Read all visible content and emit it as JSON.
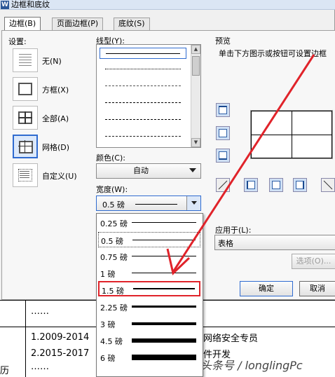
{
  "window": {
    "title": "边框和底纹",
    "icon": "word-app-icon"
  },
  "tabs": [
    {
      "label": "边框(B)"
    },
    {
      "label": "页面边框(P)"
    },
    {
      "label": "底纹(S)"
    }
  ],
  "setting": {
    "label": "设置:",
    "options": [
      {
        "label": "无(N)"
      },
      {
        "label": "方框(X)"
      },
      {
        "label": "全部(A)"
      },
      {
        "label": "网格(D)"
      },
      {
        "label": "自定义(U)"
      }
    ],
    "selected": "网格(D)"
  },
  "line_style": {
    "label": "线型(Y):"
  },
  "color": {
    "label": "颜色(C):",
    "value": "自动"
  },
  "width": {
    "label": "宽度(W):",
    "value": "0.5 磅",
    "options": [
      {
        "label": "0.25 磅"
      },
      {
        "label": "0.5 磅"
      },
      {
        "label": "0.75 磅"
      },
      {
        "label": "1 磅"
      },
      {
        "label": "1.5 磅"
      },
      {
        "label": "2.25 磅"
      },
      {
        "label": "3 磅"
      },
      {
        "label": "4.5 磅"
      },
      {
        "label": "6 磅"
      }
    ],
    "highlighted": "1.5 磅"
  },
  "preview": {
    "label": "预览",
    "hint": "单击下方图示或按钮可设置边框"
  },
  "apply_to": {
    "label": "应用于(L):",
    "value": "表格"
  },
  "buttons": {
    "options": "选项(O)...",
    "ok": "确定",
    "cancel": "取消"
  },
  "document": {
    "row1_dots": "……",
    "row2_line1": "1.2009-2014",
    "row2_line2": "2.2015-2017",
    "row2_dots": "……",
    "row2_right1": "网络安全专员",
    "row2_right2": "件开发",
    "left_char": "经历"
  },
  "watermark": "头条号 / longlingPc",
  "annotation_color": "#e0232a"
}
